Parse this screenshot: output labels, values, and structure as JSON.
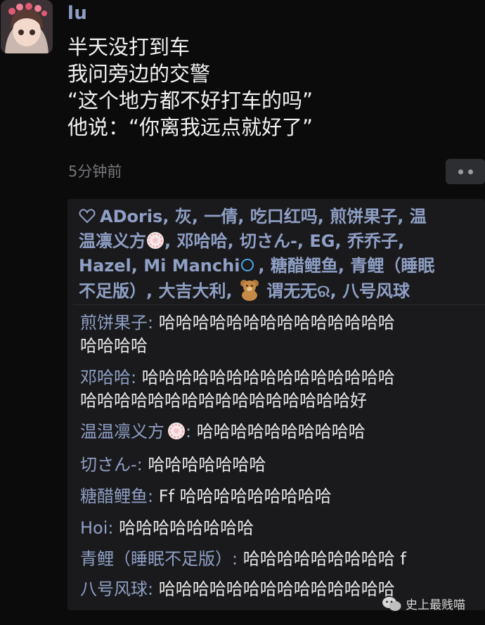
{
  "post": {
    "username": "lu",
    "lines": [
      "半天没打到车",
      "我问旁边的交警",
      "“这个地方都不好打车的吗”",
      "他说：“你离我远点就好了”"
    ],
    "timestamp": "5分钟前"
  },
  "likes": {
    "line1": {
      "a": "ADoris",
      "b": ", 灰, 一倩, 吃口红吗, 煎饼果子, 温"
    },
    "line2": {
      "a": "温凛义方",
      "b": ", 邓哈哈, 切さん-, ",
      "c": "EG",
      "d": ", 乔乔子,"
    },
    "line3": {
      "a": "Hazel",
      "b": ", ",
      "c": "Mi Manchi",
      "d": ", 糖醋鲤鱼, 青鲤（睡眠"
    },
    "line4": {
      "a": "不足版）, 大吉大利, ",
      "b": " 谓无无ର, 八号风球"
    }
  },
  "comments": [
    {
      "name": "煎饼果子",
      "sep": ": ",
      "text1": "哈哈哈哈哈哈哈哈哈哈哈哈哈哈",
      "text2": "哈哈哈哈"
    },
    {
      "name": "邓哈哈",
      "sep": ": ",
      "text1": "哈哈哈哈哈哈哈哈哈哈哈哈哈哈哈",
      "text2": "哈哈哈哈哈哈哈哈哈哈哈哈哈哈哈哈好"
    },
    {
      "name": "温温凛义方",
      "sep": ": ",
      "text1": "哈哈哈哈哈哈哈哈哈哈"
    },
    {
      "name": "切さん-",
      "sep": ": ",
      "text1": "哈哈哈哈哈哈哈"
    },
    {
      "name": "糖醋鲤鱼",
      "sep": ": ",
      "text1": "Ff 哈哈哈哈哈哈哈哈哈"
    },
    {
      "name": "Hoi",
      "sep": ": ",
      "text1": "哈哈哈哈哈哈哈哈"
    },
    {
      "name": "青鲤（睡眠不足版）",
      "sep": ": ",
      "text1": "哈哈哈哈哈哈哈哈哈 f"
    },
    {
      "name": "八号风球",
      "sep": ": ",
      "text1": "哈哈哈哈哈哈哈哈哈哈哈哈哈哈"
    }
  ],
  "watermark": {
    "text": "史上最贱喵"
  },
  "icons": {
    "like": "heart-outline-icon",
    "more": "more-dots-icon",
    "flower": "flower-emoji",
    "bear": "teddy-bear-emoji"
  },
  "colors": {
    "background": "#0b0b0c",
    "panel": "#1a1a1c",
    "name": "#8fa0c6",
    "text": "#e7e7e8",
    "muted": "#767779"
  }
}
